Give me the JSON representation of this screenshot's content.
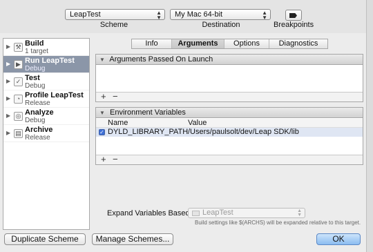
{
  "toolbar": {
    "scheme_popup_value": "LeapTest",
    "destination_popup_value": "My Mac 64-bit",
    "scheme_label": "Scheme",
    "destination_label": "Destination",
    "breakpoints_label": "Breakpoints"
  },
  "sidebar": {
    "items": [
      {
        "name": "Build",
        "sub": "1 target",
        "icon": "build-icon"
      },
      {
        "name": "Run LeapTest",
        "sub": "Debug",
        "icon": "run-icon",
        "selected": true
      },
      {
        "name": "Test",
        "sub": "Debug",
        "icon": "test-icon"
      },
      {
        "name": "Profile LeapTest",
        "sub": "Release",
        "icon": "profile-icon"
      },
      {
        "name": "Analyze",
        "sub": "Debug",
        "icon": "analyze-icon"
      },
      {
        "name": "Archive",
        "sub": "Release",
        "icon": "archive-icon"
      }
    ]
  },
  "tabs": [
    "Info",
    "Arguments",
    "Options",
    "Diagnostics"
  ],
  "active_tab": "Arguments",
  "arguments_panel": {
    "title": "Arguments Passed On Launch",
    "add_label": "+",
    "remove_label": "−"
  },
  "env_panel": {
    "title": "Environment Variables",
    "col_name": "Name",
    "col_value": "Value",
    "rows": [
      {
        "enabled": true,
        "name": "DYLD_LIBRARY_PATH",
        "value": "/Users/paulsolt/dev/Leap SDK/lib"
      }
    ],
    "add_label": "+",
    "remove_label": "−"
  },
  "expand": {
    "label": "Expand Variables Based On",
    "popup_value": "LeapTest",
    "note": "Build settings like $(ARCHS) will be expanded relative to this target."
  },
  "buttons": {
    "duplicate": "Duplicate Scheme",
    "manage": "Manage Schemes...",
    "ok": "OK"
  },
  "colors": {
    "selection": "#8b96a8",
    "ok_button": "#8bbcf0",
    "row_highlight": "#dfe6f3"
  }
}
